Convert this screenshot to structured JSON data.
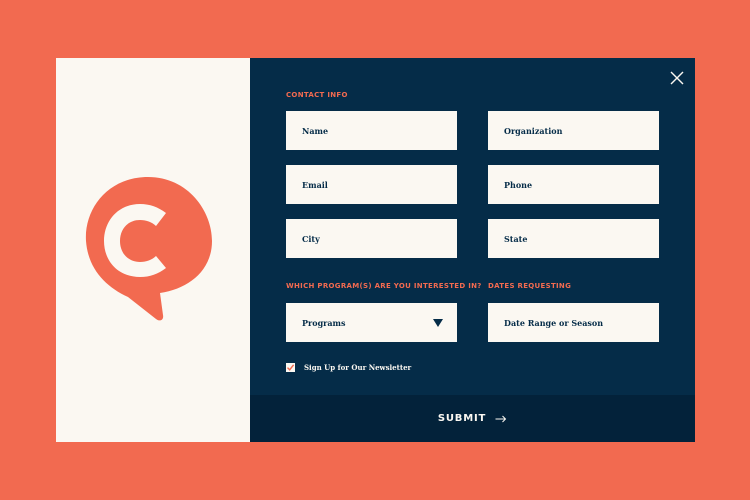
{
  "colors": {
    "background": "#F26A50",
    "accent": "#F26A50",
    "panel_dark": "#052C48",
    "submit_bar": "#03223A",
    "field_bg": "#FBF8F2"
  },
  "icons": {
    "close": "close-icon",
    "logo": "c-pin-logo",
    "select_caret": "caret-down-icon",
    "submit_arrow": "arrow-right-icon",
    "checkbox_check": "check-icon"
  },
  "form": {
    "contact_heading": "CONTACT INFO",
    "fields": {
      "name": "Name",
      "organization": "Organization",
      "email": "Email",
      "phone": "Phone",
      "city": "City",
      "state": "State"
    },
    "programs_heading": "WHICH PROGRAM(S) ARE YOU INTERESTED IN?",
    "dates_heading": "DATES REQUESTING",
    "programs_select": "Programs",
    "dates_field": "Date Range or Season",
    "newsletter_label": "Sign Up for Our Newsletter",
    "newsletter_checked": true,
    "submit_label": "SUBMIT"
  }
}
